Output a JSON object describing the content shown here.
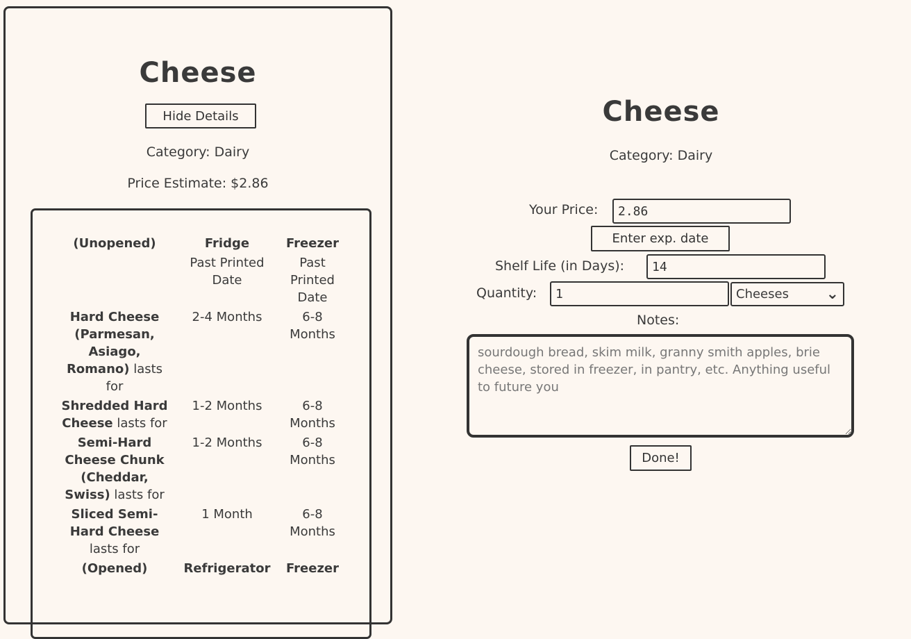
{
  "left_card": {
    "title": "Cheese",
    "hide_button": "Hide Details",
    "category_line": "Category: Dairy",
    "price_line": "Price Estimate: $2.86",
    "unopened_header": {
      "state": "(Unopened)",
      "fridge": "Fridge",
      "freezer": "Freezer"
    },
    "unopened_subheader": {
      "fridge": "Past Printed Date",
      "freezer": "Past Printed Date"
    },
    "rows": [
      {
        "name": "Hard Cheese (Parmesan, Asiago, Romano)",
        "suffix": " lasts for",
        "fridge": "2-4 Months",
        "freezer": "6-8 Months"
      },
      {
        "name": "Shredded Hard Cheese",
        "suffix": " lasts for",
        "fridge": "1-2 Months",
        "freezer": "6-8 Months"
      },
      {
        "name": "Semi-Hard Cheese Chunk (Cheddar, Swiss)",
        "suffix": " lasts for",
        "fridge": "1-2 Months",
        "freezer": "6-8 Months"
      },
      {
        "name": "Sliced Semi-Hard Cheese",
        "suffix": " lasts for",
        "fridge": "1 Month",
        "freezer": "6-8 Months"
      }
    ],
    "opened_header": {
      "state": "(Opened)",
      "fridge": "Refrigerator",
      "freezer": "Freezer"
    }
  },
  "form": {
    "title": "Cheese",
    "category_line": "Category: Dairy",
    "price_label": "Your Price:",
    "price_value": "2.86",
    "exp_button": "Enter exp. date",
    "shelf_label": "Shelf Life (in Days):",
    "shelf_value": "14",
    "quantity_label": "Quantity:",
    "quantity_value": "1",
    "unit_selected": "Cheeses",
    "notes_label": "Notes:",
    "notes_placeholder": "sourdough bread, skim milk, granny smith apples, brie cheese, stored in freezer, in pantry, etc. Anything useful to future you",
    "done_button": "Done!"
  }
}
